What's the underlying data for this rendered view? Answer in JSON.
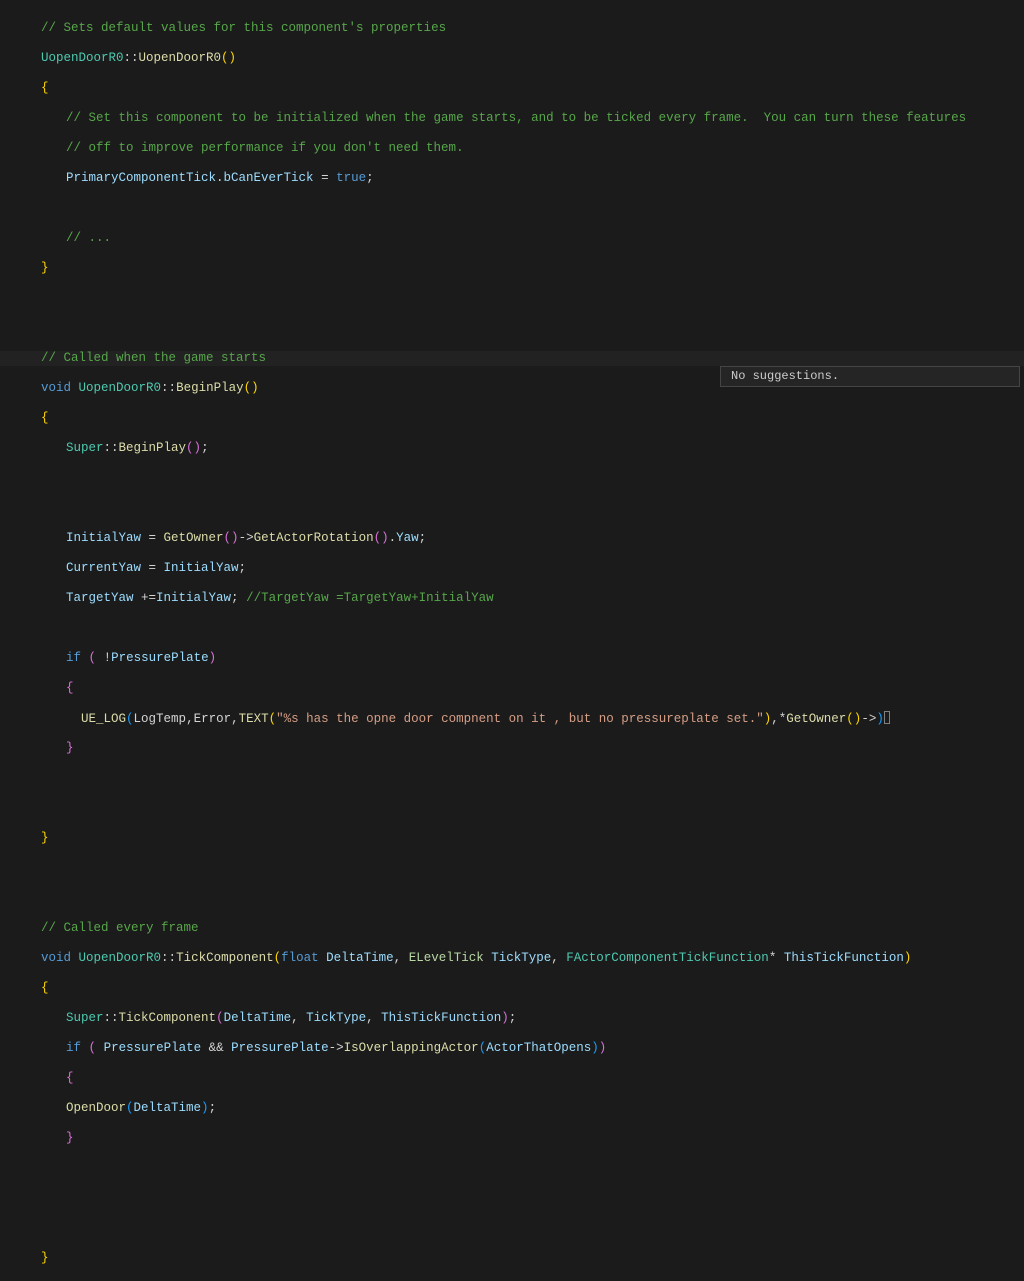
{
  "c": {
    "setsDefault": "// Sets default values for this component's properties",
    "ctorSig_class": "UopenDoorR0",
    "ctorSig_sep": "::",
    "ctorSig_name": "UopenDoorR0",
    "braceOpen": "{",
    "braceClose": "}",
    "setComp1": "// Set this component to be initialized when the game starts, and to be ticked every frame.  You can turn these features",
    "setComp2": "// off to improve performance if you don't need them.",
    "tickVar1": "PrimaryComponentTick",
    "dot": ".",
    "tickVar2": "bCanEverTick",
    "eq": " = ",
    "trueKw": "true",
    "semi": ";",
    "ellipsis": "// ...",
    "calledStarts": "// Called when the game starts",
    "voidKw": "void",
    "beginPlay": "BeginPlay",
    "parens": "()",
    "superKw": "Super",
    "initYaw": "InitialYaw",
    "getOwner": "GetOwner",
    "arrow": "->",
    "getActorRot": "GetActorRotation",
    "yawProp": "Yaw",
    "currentYaw": "CurrentYaw",
    "targetYaw": "TargetYaw",
    "plusEq": " +=",
    "targetYawComment": "//TargetYaw =TargetYaw+InitialYaw",
    "ifKw": "if",
    "not": "!",
    "pressurePlate": "PressurePlate",
    "uelog": "UE_LOG",
    "logTemp": "LogTemp",
    "comma": ",",
    "errorKw": "Error",
    "textMacro": "TEXT",
    "logStr": "\"%s has the opne door compnent on it , but no pressureplate set.\"",
    "star": "*",
    "calledEvery": "// Called every frame",
    "tickComp": "TickComponent",
    "floatKw": "float",
    "deltaTime": "DeltaTime",
    "elevelTick": "ELevelTick",
    "tickType": "TickType",
    "ftick": "FActorComponentTickFunction",
    "thisTick": "ThisTickFunction",
    "andOp": " && ",
    "isOverlap": "IsOverlappingActor",
    "actorOpens": "ActorThatOpens",
    "openDoor": "OpenDoor",
    "sp": " ",
    "open_p_y": "(",
    "close_p_y": ")",
    "open_p_p": "(",
    "close_p_p": ")",
    "open_p_b": "(",
    "close_p_b": ")",
    "open_b_y": "{",
    "close_b_y": "}",
    "open_b_p": "{",
    "close_b_p": "}"
  },
  "popup": {
    "text": "No suggestions."
  }
}
